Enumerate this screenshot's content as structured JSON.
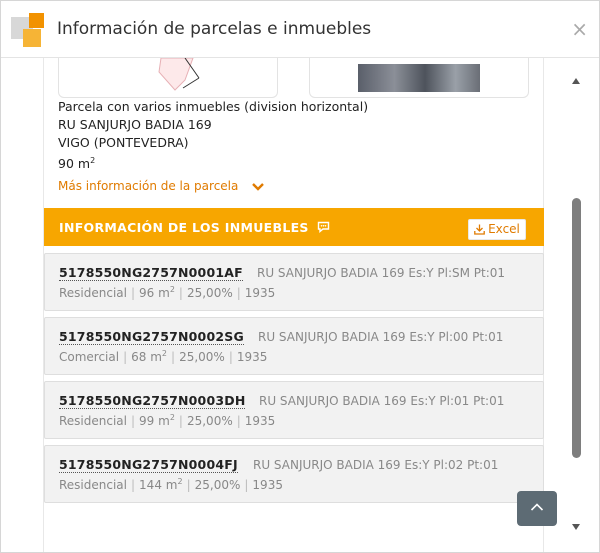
{
  "dialog": {
    "title": "Información de parcelas e inmuebles",
    "close_label": "×"
  },
  "parcel": {
    "type": "Parcela con varios inmuebles (division horizontal)",
    "address": "RU SANJURJO BADIA 169",
    "city": "VIGO (PONTEVEDRA)",
    "area_value": "90 m",
    "area_exp": "2",
    "more_link": "Más información de la parcela"
  },
  "properties_section": {
    "title": "INFORMACIÓN DE LOS INMUEBLES",
    "excel_label": "Excel"
  },
  "properties": [
    {
      "ref": "5178550NG2757N0001AF",
      "address": "RU SANJURJO BADIA 169 Es:Y Pl:SM Pt:01",
      "use": "Residencial",
      "area": "96 m",
      "area_exp": "2",
      "share": "25,00%",
      "year": "1935"
    },
    {
      "ref": "5178550NG2757N0002SG",
      "address": "RU SANJURJO BADIA 169 Es:Y Pl:00 Pt:01",
      "use": "Comercial",
      "area": "68 m",
      "area_exp": "2",
      "share": "25,00%",
      "year": "1935"
    },
    {
      "ref": "5178550NG2757N0003DH",
      "address": "RU SANJURJO BADIA 169 Es:Y Pl:01 Pt:01",
      "use": "Residencial",
      "area": "99 m",
      "area_exp": "2",
      "share": "25,00%",
      "year": "1935"
    },
    {
      "ref": "5178550NG2757N0004FJ",
      "address": "RU SANJURJO BADIA 169 Es:Y Pl:02 Pt:01",
      "use": "Residencial",
      "area": "144 m",
      "area_exp": "2",
      "share": "25,00%",
      "year": "1935"
    }
  ],
  "colors": {
    "accent": "#f7a600",
    "link": "#e07b00",
    "card_bg": "#f2f2f2",
    "to_top_button": "#5d6b74"
  },
  "icons": {
    "logo": "catastro-logo-icon",
    "close": "close-icon",
    "more": "chevron-down-icon",
    "section": "comment-bubble-icon",
    "excel": "download-icon",
    "to_top": "chevron-up-icon"
  }
}
